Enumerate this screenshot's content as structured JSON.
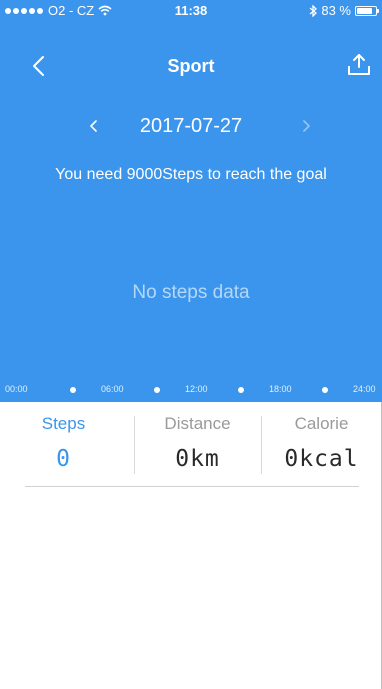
{
  "status_bar": {
    "carrier": "O2 - CZ",
    "time": "11:38",
    "battery": "83 %",
    "battery_level": 0.83,
    "icons": [
      "signal-dots",
      "wifi-icon",
      "bluetooth-icon",
      "battery-icon"
    ]
  },
  "nav": {
    "title": "Sport",
    "back_icon": "chevron-left-icon",
    "upload_icon": "upload-icon"
  },
  "date_bar": {
    "date": "2017-07-27",
    "prev_icon": "chevron-left-icon",
    "next_icon": "chevron-right-icon"
  },
  "goal_text": "You need 9000Steps to reach the goal",
  "no_data_text": "No steps data",
  "timeline": {
    "labels": [
      "00:00",
      "06:00",
      "12:00",
      "18:00",
      "24:00"
    ]
  },
  "stats": [
    {
      "label": "Steps",
      "value": "0",
      "active": true
    },
    {
      "label": "Distance",
      "value": "0km",
      "active": false
    },
    {
      "label": "Calorie",
      "value": "0kcal",
      "active": false
    }
  ],
  "colors": {
    "accent": "#3b95ec",
    "label_gray": "#9a9a9a",
    "value_dark": "#2a2a2a"
  }
}
